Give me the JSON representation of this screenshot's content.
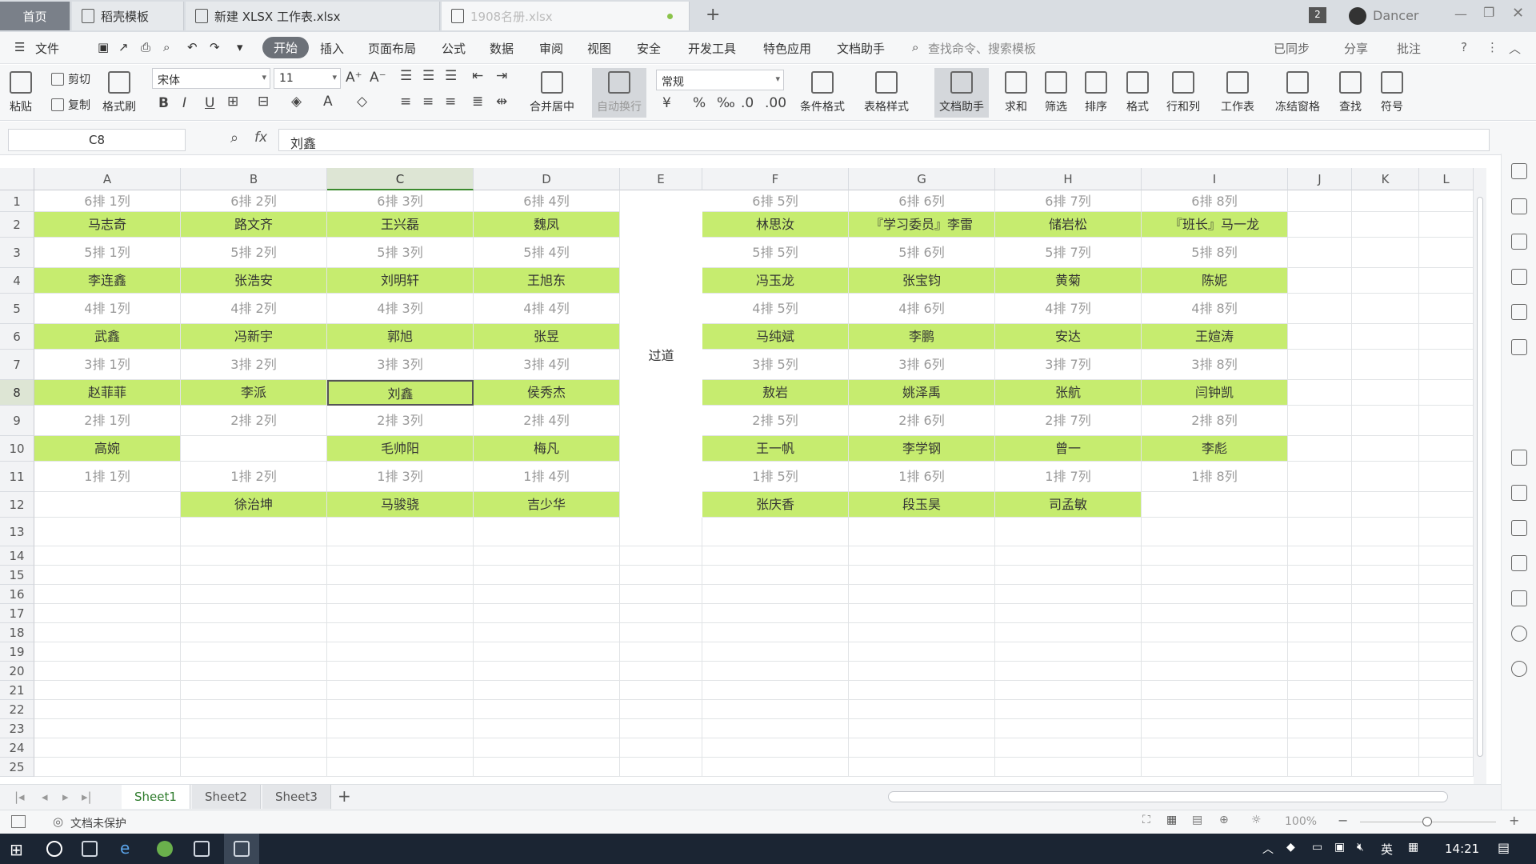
{
  "tabs": [
    {
      "label": "首页"
    },
    {
      "label": "稻壳模板"
    },
    {
      "label": "新建 XLSX 工作表.xlsx"
    },
    {
      "label": "1908名册.xlsx"
    }
  ],
  "new_tab": "+",
  "user": {
    "badge": "2",
    "name": "Dancer"
  },
  "menu": {
    "file": "文件",
    "items": [
      "开始",
      "插入",
      "页面布局",
      "公式",
      "数据",
      "审阅",
      "视图",
      "安全",
      "开发工具",
      "特色应用",
      "文档助手"
    ],
    "search_placeholder": "查找命令、搜索模板",
    "sync": "已同步",
    "share": "分享",
    "comment": "批注"
  },
  "ribbon": {
    "paste": "粘贴",
    "cut": "剪切",
    "copy": "复制",
    "format_painter": "格式刷",
    "font_name": "宋体",
    "font_size": "11",
    "merge_center": "合并居中",
    "wrap_text": "自动换行",
    "number_format": "常规",
    "cond_format": "条件格式",
    "table_style": "表格样式",
    "doc_assistant": "文档助手",
    "sum": "求和",
    "filter": "筛选",
    "sort": "排序",
    "format": "格式",
    "row_col": "行和列",
    "worksheet": "工作表",
    "freeze": "冻结窗格",
    "find": "查找",
    "symbol": "符号"
  },
  "formula_bar": {
    "cell_ref": "C8",
    "fx": "fx",
    "value": "刘鑫"
  },
  "columns": [
    "A",
    "B",
    "C",
    "D",
    "E",
    "F",
    "G",
    "H",
    "I",
    "J",
    "K",
    "L"
  ],
  "rows": [
    "1",
    "2",
    "3",
    "4",
    "5",
    "6",
    "7",
    "8",
    "9",
    "10",
    "11",
    "12",
    "13",
    "14",
    "15",
    "16",
    "17",
    "18",
    "19",
    "20",
    "21",
    "22",
    "23",
    "24",
    "25"
  ],
  "aisle_label": "过道",
  "seating": [
    [
      "6排 1列",
      "6排 2列",
      "6排 3列",
      "6排 4列",
      "6排 5列",
      "6排 6列",
      "6排 7列",
      "6排 8列"
    ],
    [
      "马志奇",
      "路文齐",
      "王兴磊",
      "魏凤",
      "林思汝",
      "『学习委员』李雷",
      "储岩松",
      "『班长』马一龙"
    ],
    [
      "5排 1列",
      "5排 2列",
      "5排 3列",
      "5排 4列",
      "5排 5列",
      "5排 6列",
      "5排 7列",
      "5排 8列"
    ],
    [
      "李连鑫",
      "张浩安",
      "刘明轩",
      "王旭东",
      "冯玉龙",
      "张宝钧",
      "黄菊",
      "陈妮"
    ],
    [
      "4排 1列",
      "4排 2列",
      "4排 3列",
      "4排 4列",
      "4排 5列",
      "4排 6列",
      "4排 7列",
      "4排 8列"
    ],
    [
      "武鑫",
      "冯新宇",
      "郭旭",
      "张昱",
      "马纯斌",
      "李鹏",
      "安达",
      "王媗涛"
    ],
    [
      "3排 1列",
      "3排 2列",
      "3排 3列",
      "3排 4列",
      "3排 5列",
      "3排 6列",
      "3排 7列",
      "3排 8列"
    ],
    [
      "赵菲菲",
      "李派",
      "刘鑫",
      "侯秀杰",
      "敖岩",
      "姚泽禹",
      "张航",
      "闫钟凯"
    ],
    [
      "2排 1列",
      "2排 2列",
      "2排 3列",
      "2排 4列",
      "2排 5列",
      "2排 6列",
      "2排 7列",
      "2排 8列"
    ],
    [
      "高婉",
      "",
      "毛帅阳",
      "梅凡",
      "王一帆",
      "李学钢",
      "曾一",
      "李彪"
    ],
    [
      "1排 1列",
      "1排 2列",
      "1排 3列",
      "1排 4列",
      "1排 5列",
      "1排 6列",
      "1排 7列",
      "1排 8列"
    ],
    [
      "",
      "徐治坤",
      "马骏骁",
      "吉少华",
      "张庆香",
      "段玉昊",
      "司孟敏",
      ""
    ]
  ],
  "sheets": [
    "Sheet1",
    "Sheet2",
    "Sheet3"
  ],
  "add_sheet": "+",
  "status": {
    "protect": "文档未保护",
    "zoom": "100%"
  },
  "taskbar": {
    "time": "14:21",
    "ime": "英"
  }
}
